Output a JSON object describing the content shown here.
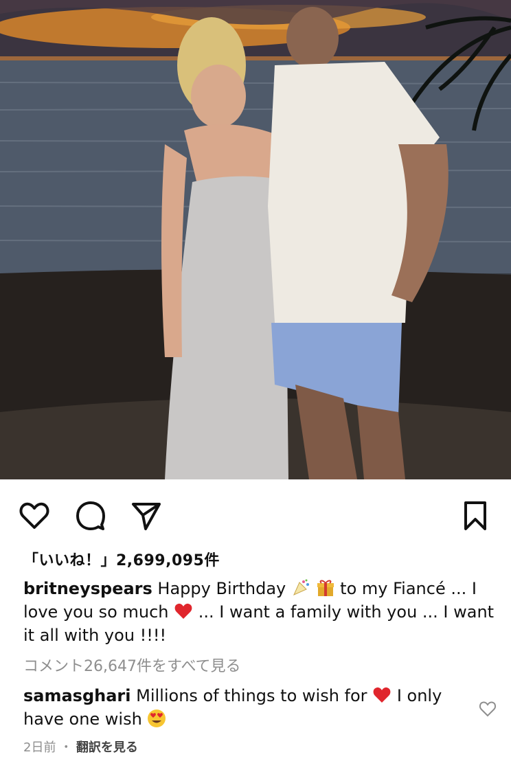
{
  "post": {
    "image_alt": "Couple at sunset beach",
    "likes_text": "「いいね！」2,699,095件",
    "caption_user": "britneyspears",
    "caption_text_1": "Happy Birthday",
    "caption_text_2": "to my Fiancé ... I love you so much",
    "caption_text_3": "... I want a family with you ...  I want it all with you !!!!",
    "view_comments": "コメント26,647件をすべて見る",
    "comment_user": "samasghari",
    "comment_text_1": "Millions of things to wish for",
    "comment_text_2": "I only have one wish",
    "date": "2日前",
    "separator": "・",
    "translate_label": "翻訳を見る"
  },
  "icons": {
    "like": "heart-icon",
    "comment": "comment-icon",
    "share": "send-icon",
    "save": "bookmark-icon"
  }
}
